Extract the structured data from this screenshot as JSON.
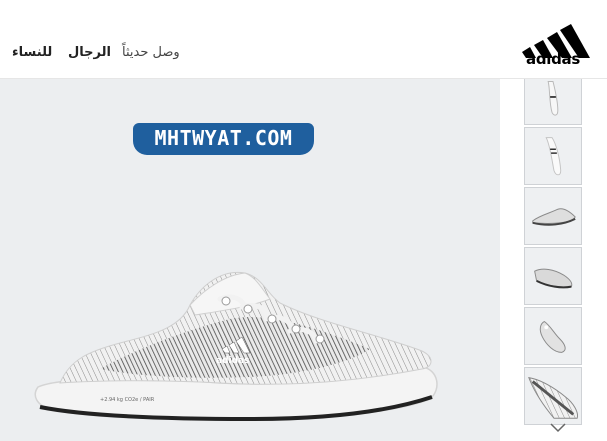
{
  "header": {
    "brand": "adidas",
    "nav": {
      "new_arrivals": "وصل حديثاً",
      "men": "الرجال",
      "women": "للنساء"
    }
  },
  "hero": {
    "watermark": "MHTWYAT.COM",
    "shoe_text": "adidas",
    "shoe_print": "+2.94 kg CO2e / PAIR"
  },
  "thumbnails": {
    "count": 6,
    "scroll_icon": "chevron-down-icon"
  },
  "colors": {
    "hero_bg": "#eceef0",
    "watermark_bg": "#1f5f9e",
    "text": "#222222"
  }
}
